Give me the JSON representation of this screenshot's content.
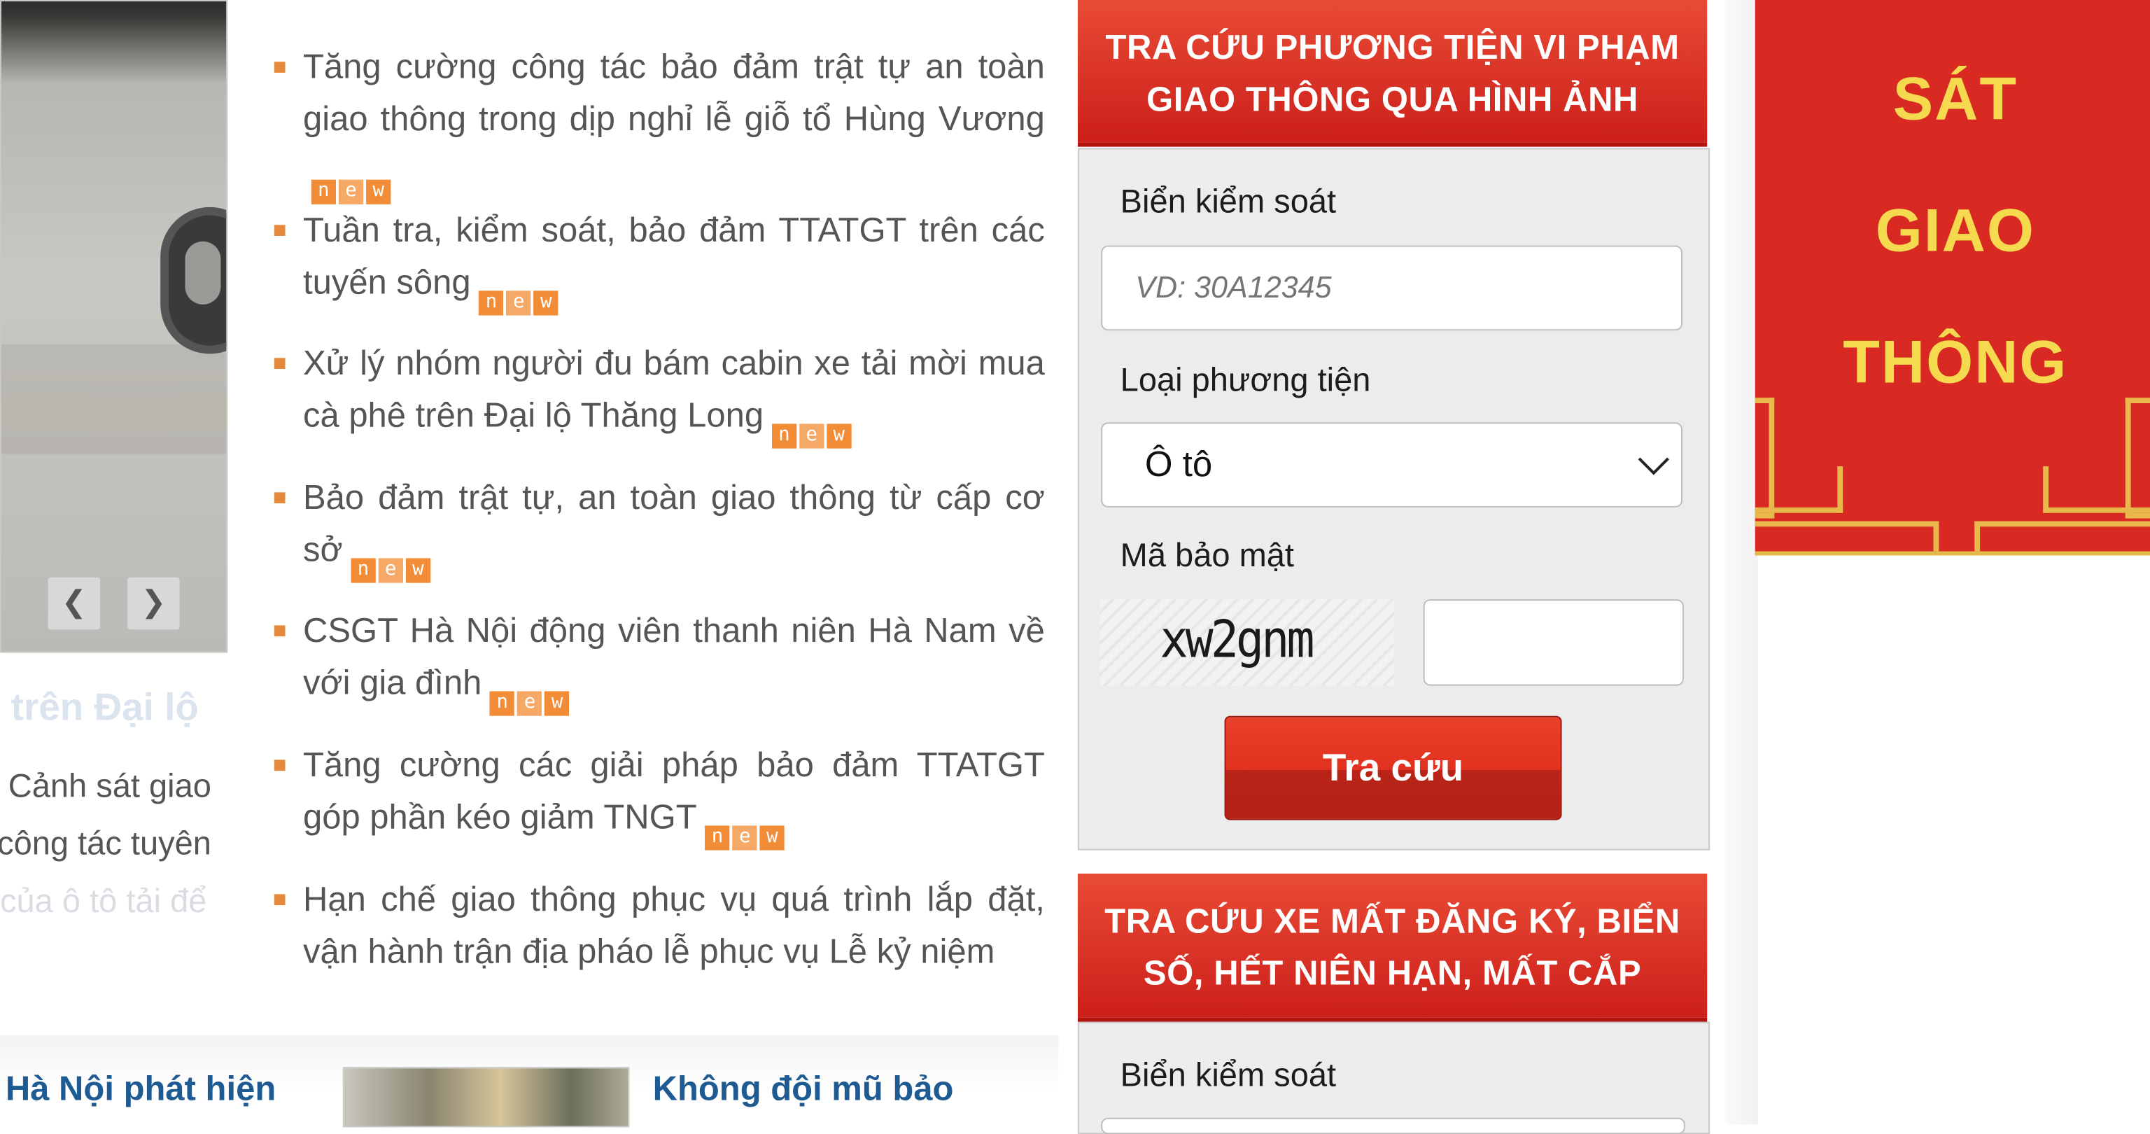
{
  "news": {
    "items": [
      {
        "text": "Tăng cường công tác bảo đảm trật tự an toàn giao thông trong dịp nghỉ lễ giỗ tổ Hùng Vương",
        "badge": "new"
      },
      {
        "text": "Tuần tra, kiểm soát, bảo đảm TTATGT trên các tuyến sông",
        "badge": "new"
      },
      {
        "text": "Xử lý nhóm người đu bám cabin xe tải mời mua cà phê trên Đại lộ Thăng Long",
        "badge": "new"
      },
      {
        "text": "Bảo đảm trật tự, an toàn giao thông từ cấp cơ sở",
        "badge": "new"
      },
      {
        "text": "CSGT Hà Nội động viên thanh niên Hà Nam về với gia đình",
        "badge": "new"
      },
      {
        "text": "Tăng cường các giải pháp bảo đảm TTATGT góp phần kéo giảm TNGT",
        "badge": "new"
      },
      {
        "text": "Hạn chế giao thông phục vụ quá trình lắp đặt, vận hành trận địa pháo lễ phục vụ Lễ kỷ niệm",
        "badge": ""
      }
    ]
  },
  "featured": {
    "title_fragment": "trên Đại lộ",
    "lines": [
      "Cảnh sát giao",
      "công tác tuyên",
      "của ô tô tải để"
    ],
    "prev_icon": "chevron-left-icon",
    "next_icon": "chevron-right-icon"
  },
  "related": {
    "left_title": "Hà Nội phát hiện",
    "right_title": "Không đội mũ bảo"
  },
  "lookup_violation": {
    "title_line1": "TRA CỨU PHƯƠNG TIỆN VI PHẠM",
    "title_line2": "GIAO THÔNG QUA HÌNH ẢNH",
    "plate_label": "Biển kiểm soát",
    "plate_placeholder": "VD: 30A12345",
    "vehicle_label": "Loại phương tiện",
    "vehicle_value": "Ô tô",
    "captcha_label": "Mã bảo mật",
    "captcha_text": "xw2gnm",
    "submit_label": "Tra cứu"
  },
  "lookup_stolen": {
    "title_line1": "TRA CỨU XE MẤT ĐĂNG KÝ, BIỂN",
    "title_line2": "SỐ, HẾT NIÊN HẠN, MẤT CẮP",
    "plate_label": "Biển kiểm soát"
  },
  "banner": {
    "line1": "SÁT",
    "line2": "GIAO",
    "line3": "THÔNG"
  },
  "colors": {
    "header_red": "#cc1f1a",
    "link_blue": "#1f5b93",
    "badge_orange": "#f28c37",
    "banner_gold": "#f5d94e"
  }
}
